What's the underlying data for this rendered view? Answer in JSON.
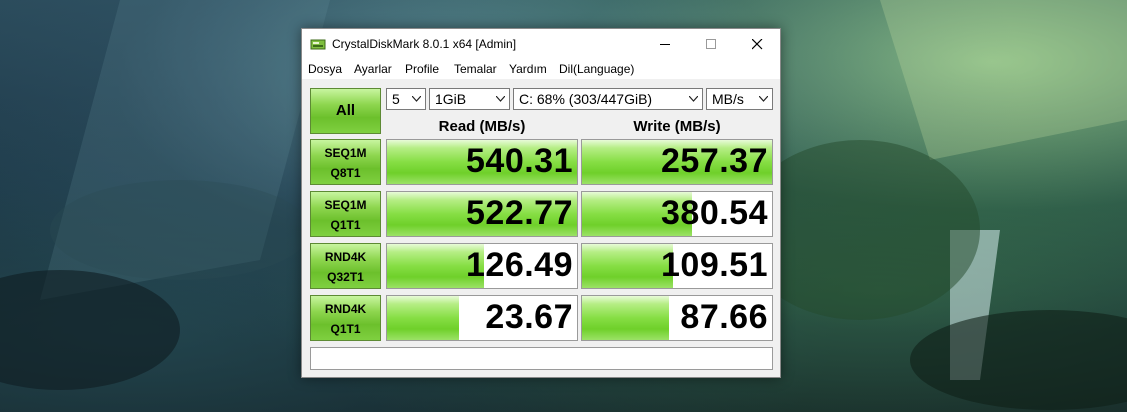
{
  "window": {
    "title": "CrystalDiskMark 8.0.1 x64 [Admin]",
    "controls": {
      "minimize": "minimize-icon",
      "maximize": "maximize-icon",
      "close": "close-icon"
    }
  },
  "menu": [
    "Dosya",
    "Ayarlar",
    "Profile",
    "Temalar",
    "Yardım",
    "Dil(Language)"
  ],
  "toolbar": {
    "all_label": "All",
    "count": "5",
    "size": "1GiB",
    "drive": "C: 68% (303/447GiB)",
    "unit": "MB/s"
  },
  "headers": {
    "read": "Read (MB/s)",
    "write": "Write (MB/s)"
  },
  "tests": [
    {
      "line1": "SEQ1M",
      "line2": "Q8T1",
      "read": "540.31",
      "write": "257.37",
      "read_fill": 1.0,
      "write_fill": 1.0
    },
    {
      "line1": "SEQ1M",
      "line2": "Q1T1",
      "read": "522.77",
      "write": "380.54",
      "read_fill": 1.0,
      "write_fill": 0.58
    },
    {
      "line1": "RND4K",
      "line2": "Q32T1",
      "read": "126.49",
      "write": "109.51",
      "read_fill": 0.51,
      "write_fill": 0.48
    },
    {
      "line1": "RND4K",
      "line2": "Q1T1",
      "read": "23.67",
      "write": "87.66",
      "read_fill": 0.38,
      "write_fill": 0.46
    }
  ],
  "status_text": "",
  "colors": {
    "accent_green": "#6cc02c",
    "bar_green": "#86de44",
    "window_bg": "#f0f0f0"
  }
}
